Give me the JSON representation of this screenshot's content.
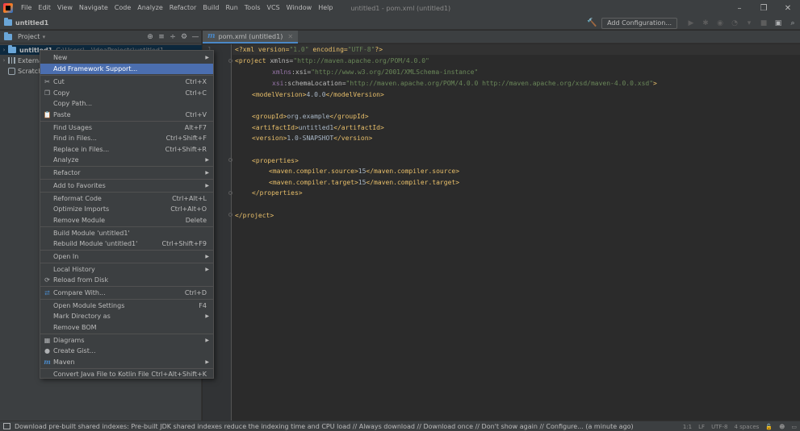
{
  "titlebar": {
    "menus": [
      "File",
      "Edit",
      "View",
      "Navigate",
      "Code",
      "Analyze",
      "Refactor",
      "Build",
      "Run",
      "Tools",
      "VCS",
      "Window",
      "Help"
    ],
    "title": "untitled1 - pom.xml (untitled1)",
    "minimize": "–",
    "restore": "❐",
    "close": "✕"
  },
  "navbar": {
    "crumb": "untitled1",
    "add_config": "Add Configuration..."
  },
  "project": {
    "title": "Project",
    "rows": [
      {
        "label": "untitled1",
        "path": "C:\\Users\\...\\IdeaProjects\\untitled1"
      },
      {
        "label": "External Libraries"
      },
      {
        "label": "Scratches and Consoles"
      }
    ]
  },
  "editor": {
    "tab_label": "pom.xml (untitled1)",
    "line_number": "1",
    "lines": [
      {
        "xml_open": "<?xml version=",
        "v1": "\"1.0\"",
        "mid": " encoding=",
        "v2": "\"UTF-8\"",
        "close": "?>"
      },
      {
        "tag": "<project",
        "attr": " xmlns=",
        "val": "\"http://maven.apache.org/POM/4.0.0\""
      },
      {
        "ns": "xmlns",
        "attr": ":xsi=",
        "val": "\"http://www.w3.org/2001/XMLSchema-instance\""
      },
      {
        "ns": "xsi",
        "attr": ":schemaLocation=",
        "val": "\"http://maven.apache.org/POM/4.0.0 http://maven.apache.org/xsd/maven-4.0.0.xsd\"",
        "end": ">"
      },
      {
        "open": "<modelVersion>",
        "text": "4.0.0",
        "close": "</modelVersion>"
      },
      {
        "open": "<groupId>",
        "text": "org.example",
        "close": "</groupId>"
      },
      {
        "open": "<artifactId>",
        "text": "untitled1",
        "close": "</artifactId>"
      },
      {
        "open": "<version>",
        "text": "1.0-SNAPSHOT",
        "close": "</version>"
      },
      {
        "open": "<properties>"
      },
      {
        "open": "<maven.compiler.source>",
        "text": "15",
        "close": "</maven.compiler.source>"
      },
      {
        "open": "<maven.compiler.target>",
        "text": "15",
        "close": "</maven.compiler.target>"
      },
      {
        "open": "</properties>"
      },
      {
        "open": "</project>"
      }
    ]
  },
  "context_menu": {
    "items": [
      {
        "label": "New",
        "submenu": true
      },
      {
        "label": "Add Framework Support...",
        "highlight": true
      },
      {
        "label": "Cut",
        "shortcut": "Ctrl+X",
        "icon": "✂"
      },
      {
        "label": "Copy",
        "shortcut": "Ctrl+C",
        "icon": "❐"
      },
      {
        "label": "Copy Path..."
      },
      {
        "label": "Paste",
        "shortcut": "Ctrl+V",
        "icon": "📋"
      },
      {
        "label": "Find Usages",
        "shortcut": "Alt+F7"
      },
      {
        "label": "Find in Files...",
        "shortcut": "Ctrl+Shift+F"
      },
      {
        "label": "Replace in Files...",
        "shortcut": "Ctrl+Shift+R"
      },
      {
        "label": "Analyze",
        "submenu": true
      },
      {
        "label": "Refactor",
        "submenu": true
      },
      {
        "label": "Add to Favorites",
        "submenu": true
      },
      {
        "label": "Reformat Code",
        "shortcut": "Ctrl+Alt+L"
      },
      {
        "label": "Optimize Imports",
        "shortcut": "Ctrl+Alt+O"
      },
      {
        "label": "Remove Module",
        "shortcut": "Delete"
      },
      {
        "label": "Build Module 'untitled1'"
      },
      {
        "label": "Rebuild Module 'untitled1'",
        "shortcut": "Ctrl+Shift+F9"
      },
      {
        "label": "Open In",
        "submenu": true
      },
      {
        "label": "Local History",
        "submenu": true
      },
      {
        "label": "Reload from Disk",
        "icon": "⟳"
      },
      {
        "label": "Compare With...",
        "shortcut": "Ctrl+D",
        "icon": "⇄"
      },
      {
        "label": "Open Module Settings",
        "shortcut": "F4"
      },
      {
        "label": "Mark Directory as",
        "submenu": true
      },
      {
        "label": "Remove BOM"
      },
      {
        "label": "Diagrams",
        "submenu": true,
        "icon": "▦"
      },
      {
        "label": "Create Gist...",
        "icon": "●"
      },
      {
        "label": "Maven",
        "submenu": true,
        "icon": "m"
      },
      {
        "label": "Convert Java File to Kotlin File",
        "shortcut": "Ctrl+Alt+Shift+K"
      }
    ]
  },
  "statusbar": {
    "message": "Download pre-built shared indexes: Pre-built JDK shared indexes reduce the indexing time and CPU load // Always download // Download once // Don't show again // Configure... (a minute ago)",
    "position": "1:1",
    "line_sep": "LF",
    "encoding": "UTF-8",
    "indent": "4 spaces"
  },
  "colors": {
    "highlight": "#4b6eaf",
    "bg": "#2b2b2b",
    "panel": "#3c3f41"
  }
}
